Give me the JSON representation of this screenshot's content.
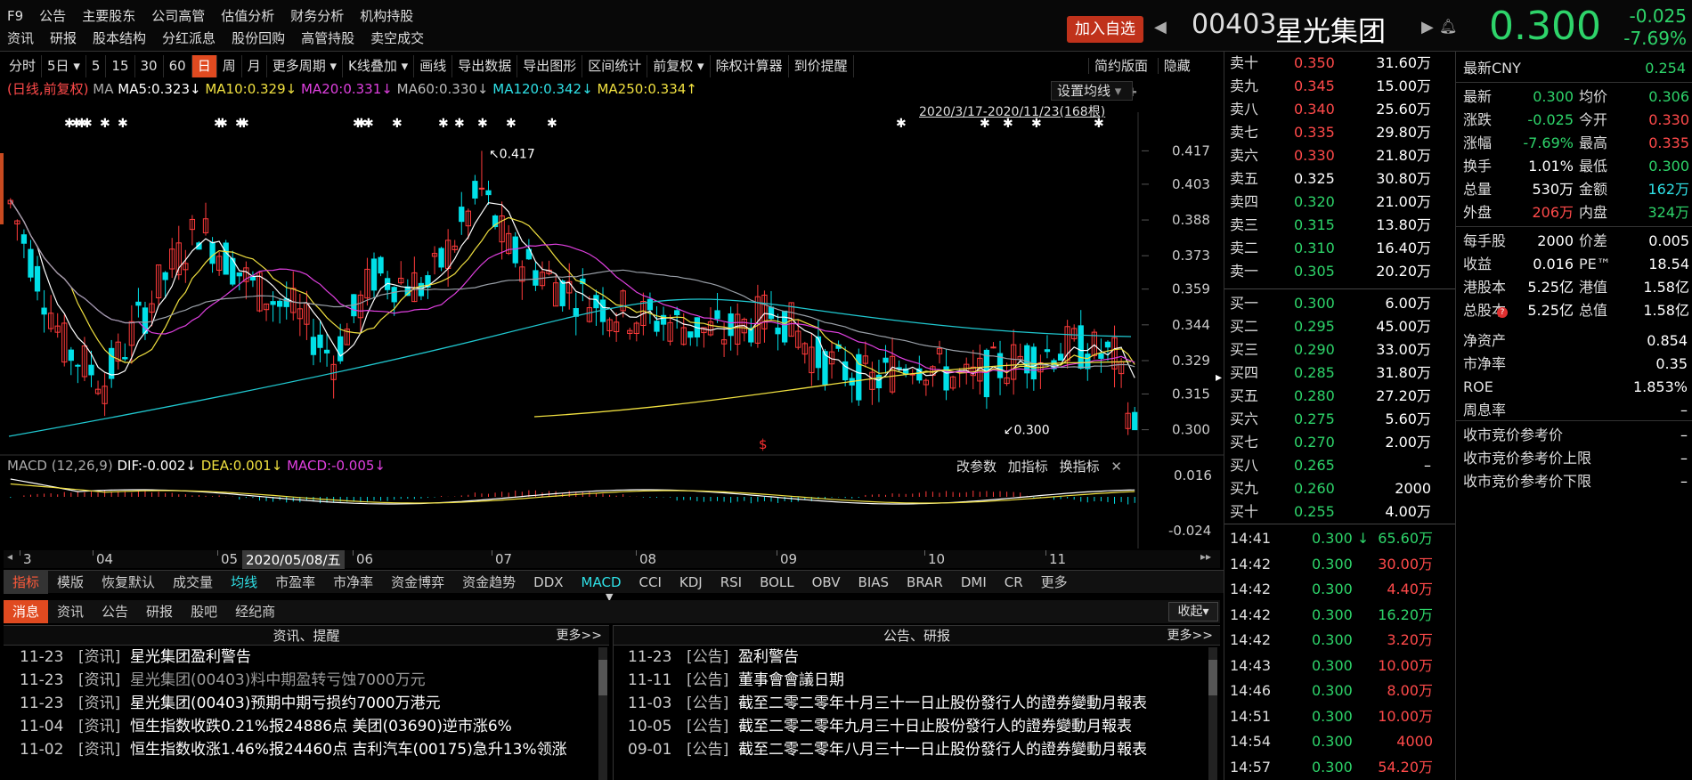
{
  "menu": {
    "row1": [
      "F9",
      "公告",
      "主要股东",
      "公司高管",
      "估值分析",
      "财务分析",
      "机构持股"
    ],
    "row2": [
      "资讯",
      "研报",
      "股本结构",
      "分红派息",
      "股份回购",
      "高管持股",
      "卖空成交"
    ]
  },
  "header": {
    "add_watch": "加入自选",
    "code": "00403",
    "name": "星光集团",
    "price": "0.300",
    "change": "-0.025",
    "change_pct": "-7.69%"
  },
  "toolbar": [
    "分时",
    "5日",
    "5",
    "15",
    "30",
    "60",
    "日",
    "周",
    "月",
    "更多周期",
    "K线叠加",
    "画线",
    "导出数据",
    "导出图形",
    "区间统计",
    "前复权",
    "除权计算器",
    "到价提醒"
  ],
  "toolbar_active": "日",
  "toolbar_right": [
    "简约版面",
    "隐藏"
  ],
  "ma_legend": {
    "prefix": "(日线,前复权)",
    "ma": "MA",
    "ma5": "MA5:0.323↓",
    "ma10": "MA10:0.329↓",
    "ma20": "MA20:0.331↓",
    "ma60": "MA60:0.330↓",
    "ma120": "MA120:0.342↓",
    "ma250": "MA250:0.334↑"
  },
  "settings_ma": "设置均线",
  "range_label": "2020/3/17-2020/11/23(168根)",
  "high_label": "0.417",
  "low_label": "0.300",
  "price_axis": [
    "0.417",
    "0.403",
    "0.388",
    "0.373",
    "0.359",
    "0.344",
    "0.329",
    "0.315",
    "0.300"
  ],
  "macd": {
    "title": "MACD (12,26,9)",
    "dif": "DIF:-0.002↓",
    "dea": "DEA:0.001↓",
    "macd": "MACD:-0.005↓",
    "axis_top": "0.016",
    "axis_bottom": "-0.024",
    "btn_params": "改参数",
    "btn_add": "加指标",
    "btn_switch": "换指标"
  },
  "time_axis": {
    "months": [
      "3",
      "04",
      "05",
      "06",
      "07",
      "08",
      "09",
      "10",
      "11"
    ],
    "cursor_date": "2020/05/08/五"
  },
  "chart_colors": {
    "up": "#ff3b3b",
    "down": "#00e0e8",
    "ma5": "#ffffff",
    "ma10": "#f0e040",
    "ma20": "#e040e0",
    "ma60": "#9aa0a8",
    "ma120": "#20c8d0",
    "ma250": "#f0e040"
  },
  "indicator_tabs": [
    "指标",
    "模版",
    "恢复默认",
    "成交量",
    "均线",
    "市盈率",
    "市净率",
    "资金博弈",
    "资金趋势",
    "DDX",
    "MACD",
    "CCI",
    "KDJ",
    "RSI",
    "BOLL",
    "OBV",
    "BIAS",
    "BRAR",
    "DMI",
    "CR",
    "更多"
  ],
  "news_tabs": [
    "消息",
    "资讯",
    "公告",
    "研报",
    "股吧",
    "经纪商"
  ],
  "collapse": "收起",
  "news_left": {
    "title": "资讯、提醒",
    "more": "更多>>",
    "items": [
      {
        "date": "11-23",
        "tag": "[资讯]",
        "text": "星光集团盈利警告"
      },
      {
        "date": "11-23",
        "tag": "[资讯]",
        "text": "星光集团(00403)料中期盈转亏蚀7000万元"
      },
      {
        "date": "11-23",
        "tag": "[资讯]",
        "text": "星光集团(00403)预期中期亏损约7000万港元"
      },
      {
        "date": "11-04",
        "tag": "[资讯]",
        "text": "恒生指数收跌0.21%报24886点 美团(03690)逆市涨6%"
      },
      {
        "date": "11-02",
        "tag": "[资讯]",
        "text": "恒生指数收涨1.46%报24460点 吉利汽车(00175)急升13%领涨"
      }
    ]
  },
  "news_right": {
    "title": "公告、研报",
    "more": "更多>>",
    "items": [
      {
        "date": "11-23",
        "tag": "[公告]",
        "text": "盈利警告"
      },
      {
        "date": "11-11",
        "tag": "[公告]",
        "text": "董事會會議日期"
      },
      {
        "date": "11-03",
        "tag": "[公告]",
        "text": "截至二零二零年十月三十一日止股份發行人的證券變動月報表"
      },
      {
        "date": "10-05",
        "tag": "[公告]",
        "text": "截至二零二零年九月三十日止股份發行人的證券變動月報表"
      },
      {
        "date": "09-01",
        "tag": "[公告]",
        "text": "截至二零二零年八月三十一日止股份發行人的證券變動月報表"
      }
    ]
  },
  "asks": [
    {
      "label": "卖十",
      "price": "0.350",
      "vol": "31.60万",
      "color": "red"
    },
    {
      "label": "卖九",
      "price": "0.345",
      "vol": "15.00万",
      "color": "red"
    },
    {
      "label": "卖八",
      "price": "0.340",
      "vol": "25.60万",
      "color": "red"
    },
    {
      "label": "卖七",
      "price": "0.335",
      "vol": "29.80万",
      "color": "red"
    },
    {
      "label": "卖六",
      "price": "0.330",
      "vol": "21.80万",
      "color": "red"
    },
    {
      "label": "卖五",
      "price": "0.325",
      "vol": "30.80万",
      "color": "white"
    },
    {
      "label": "卖四",
      "price": "0.320",
      "vol": "21.00万",
      "color": "green"
    },
    {
      "label": "卖三",
      "price": "0.315",
      "vol": "13.80万",
      "color": "green"
    },
    {
      "label": "卖二",
      "price": "0.310",
      "vol": "16.40万",
      "color": "green"
    },
    {
      "label": "卖一",
      "price": "0.305",
      "vol": "20.20万",
      "color": "green"
    }
  ],
  "bids": [
    {
      "label": "买一",
      "price": "0.300",
      "vol": "6.00万",
      "color": "green"
    },
    {
      "label": "买二",
      "price": "0.295",
      "vol": "45.00万",
      "color": "green"
    },
    {
      "label": "买三",
      "price": "0.290",
      "vol": "33.00万",
      "color": "green"
    },
    {
      "label": "买四",
      "price": "0.285",
      "vol": "31.80万",
      "color": "green"
    },
    {
      "label": "买五",
      "price": "0.280",
      "vol": "27.20万",
      "color": "green"
    },
    {
      "label": "买六",
      "price": "0.275",
      "vol": "5.60万",
      "color": "green"
    },
    {
      "label": "买七",
      "price": "0.270",
      "vol": "2.00万",
      "color": "green"
    },
    {
      "label": "买八",
      "price": "0.265",
      "vol": "–",
      "color": "green"
    },
    {
      "label": "买九",
      "price": "0.260",
      "vol": "2000",
      "color": "green"
    },
    {
      "label": "买十",
      "price": "0.255",
      "vol": "4.00万",
      "color": "green"
    }
  ],
  "ticks": [
    {
      "time": "14:41",
      "price": "0.300 ↓",
      "vol": "65.60万",
      "vcolor": "green"
    },
    {
      "time": "14:42",
      "price": "0.300",
      "vol": "30.00万",
      "vcolor": "red"
    },
    {
      "time": "14:42",
      "price": "0.300",
      "vol": "4.40万",
      "vcolor": "red"
    },
    {
      "time": "14:42",
      "price": "0.300",
      "vol": "16.20万",
      "vcolor": "green"
    },
    {
      "time": "14:42",
      "price": "0.300",
      "vol": "3.20万",
      "vcolor": "red"
    },
    {
      "time": "14:43",
      "price": "0.300",
      "vol": "10.00万",
      "vcolor": "red"
    },
    {
      "time": "14:46",
      "price": "0.300",
      "vol": "8.00万",
      "vcolor": "red"
    },
    {
      "time": "14:51",
      "price": "0.300",
      "vol": "10.00万",
      "vcolor": "red"
    },
    {
      "time": "14:54",
      "price": "0.300",
      "vol": "4000",
      "vcolor": "red"
    },
    {
      "time": "14:57",
      "price": "0.300",
      "vol": "54.20万",
      "vcolor": "red"
    }
  ],
  "info": {
    "latest_label": "最新CNY",
    "latest_cny": "0.254",
    "rows": [
      [
        {
          "k": "最新",
          "v": "0.300",
          "c": "green"
        },
        {
          "k": "均价",
          "v": "0.306",
          "c": "green"
        }
      ],
      [
        {
          "k": "涨跌",
          "v": "-0.025",
          "c": "green"
        },
        {
          "k": "今开",
          "v": "0.330",
          "c": "red"
        }
      ],
      [
        {
          "k": "涨幅",
          "v": "-7.69%",
          "c": "green"
        },
        {
          "k": "最高",
          "v": "0.335",
          "c": "red"
        }
      ],
      [
        {
          "k": "换手",
          "v": "1.01%",
          "c": "white"
        },
        {
          "k": "最低",
          "v": "0.300",
          "c": "green"
        }
      ],
      [
        {
          "k": "总量",
          "v": "530万",
          "c": "white"
        },
        {
          "k": "金额",
          "v": "162万",
          "c": "cyan"
        }
      ],
      [
        {
          "k": "外盘",
          "v": "206万",
          "c": "red"
        },
        {
          "k": "内盘",
          "v": "324万",
          "c": "green"
        }
      ],
      [
        {
          "k": "每手股",
          "v": "2000",
          "c": "white"
        },
        {
          "k": "价差",
          "v": "0.005",
          "c": "white"
        }
      ],
      [
        {
          "k": "收益",
          "v": "0.016",
          "c": "white"
        },
        {
          "k": "PE™",
          "v": "18.54",
          "c": "white"
        }
      ],
      [
        {
          "k": "港股本",
          "v": "5.25亿",
          "c": "white"
        },
        {
          "k": "港值",
          "v": "1.58亿",
          "c": "white"
        }
      ],
      [
        {
          "k": "总股本",
          "v": "5.25亿",
          "c": "white"
        },
        {
          "k": "总值",
          "v": "1.58亿",
          "c": "white"
        }
      ]
    ],
    "single": [
      {
        "k": "净资产",
        "v": "0.854"
      },
      {
        "k": "市净率",
        "v": "0.35"
      },
      {
        "k": "ROE",
        "v": "1.853%"
      },
      {
        "k": "周息率",
        "v": "–"
      }
    ],
    "auction": [
      {
        "k": "收市竞价参考价",
        "v": "–"
      },
      {
        "k": "收市竞价参考价上限",
        "v": "–"
      },
      {
        "k": "收市竞价参考价下限",
        "v": "–"
      }
    ]
  }
}
